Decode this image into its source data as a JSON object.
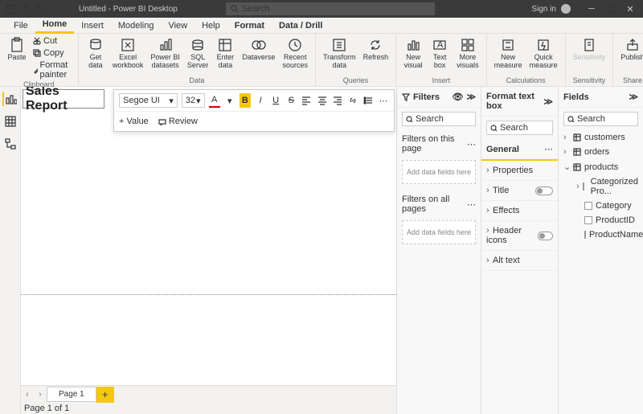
{
  "titlebar": {
    "title": "Untitled - Power BI Desktop",
    "search_placeholder": "Search",
    "signin": "Sign in"
  },
  "tabs": {
    "file": "File",
    "home": "Home",
    "insert": "Insert",
    "modeling": "Modeling",
    "view": "View",
    "help": "Help",
    "format": "Format",
    "datadrill": "Data / Drill"
  },
  "ribbon": {
    "clipboard": {
      "paste": "Paste",
      "cut": "Cut",
      "copy": "Copy",
      "format_painter": "Format painter",
      "label": "Clipboard"
    },
    "data": {
      "get_data": "Get\ndata",
      "excel": "Excel\nworkbook",
      "pbi": "Power BI\ndatasets",
      "sql": "SQL\nServer",
      "enter": "Enter\ndata",
      "dataverse": "Dataverse",
      "recent": "Recent\nsources",
      "label": "Data"
    },
    "queries": {
      "transform": "Transform\ndata",
      "refresh": "Refresh",
      "label": "Queries"
    },
    "insert": {
      "new_visual": "New\nvisual",
      "text_box": "Text\nbox",
      "more": "More\nvisuals",
      "label": "Insert"
    },
    "calc": {
      "new_measure": "New\nmeasure",
      "quick": "Quick\nmeasure",
      "label": "Calculations"
    },
    "sensitivity": {
      "btn": "Sensitivity",
      "label": "Sensitivity"
    },
    "share": {
      "publish": "Publish",
      "label": "Share"
    }
  },
  "textbox": {
    "content": "Sales Report"
  },
  "floatbar": {
    "font": "Segoe UI",
    "size": "32",
    "add_value": "Value",
    "review": "Review"
  },
  "pages": {
    "page1": "Page 1"
  },
  "status": {
    "text": "Page 1 of 1"
  },
  "filters": {
    "title": "Filters",
    "search": "Search",
    "on_page": "Filters on this page",
    "on_all": "Filters on all pages",
    "placeholder": "Add data fields here"
  },
  "format": {
    "title": "Format text box",
    "search": "Search",
    "general": "General",
    "properties": "Properties",
    "title_sect": "Title",
    "effects": "Effects",
    "header_icons": "Header icons",
    "alt_text": "Alt text"
  },
  "fields": {
    "title": "Fields",
    "search": "Search",
    "tables": {
      "customers": "customers",
      "orders": "orders",
      "products": "products",
      "products_children": {
        "categorized": "Categorized Pro...",
        "category": "Category",
        "productid": "ProductID",
        "productname": "ProductName"
      }
    }
  }
}
